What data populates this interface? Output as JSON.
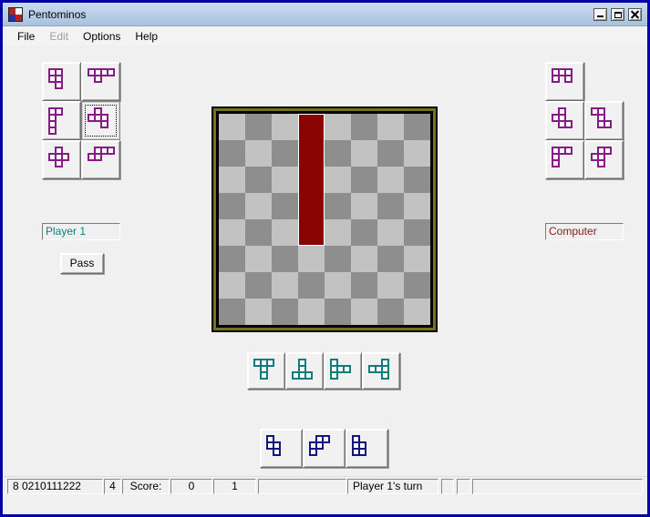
{
  "window": {
    "title": "Pentominos"
  },
  "menu": {
    "items": [
      {
        "label": "File",
        "enabled": true
      },
      {
        "label": "Edit",
        "enabled": false
      },
      {
        "label": "Options",
        "enabled": true
      },
      {
        "label": "Help",
        "enabled": true
      }
    ]
  },
  "players": {
    "left": {
      "name": "Player 1",
      "name_color": "#0e8080"
    },
    "right": {
      "name": "Computer",
      "name_color": "#8b1a1a"
    }
  },
  "pass_button": {
    "label": "Pass"
  },
  "board": {
    "rows": 8,
    "cols": 8,
    "cell_size": 29,
    "light_color": "#c2c2c2",
    "dark_color": "#8e8e8e",
    "placed_piece": {
      "name": "I-pentomino",
      "color": "#8b0404",
      "col": 3,
      "row": 0,
      "width_cells": 1,
      "height_cells": 5
    }
  },
  "pieces": {
    "player_left": {
      "color": "#871a87",
      "items": [
        {
          "name": "P-pentomino",
          "cells": [
            [
              0,
              0
            ],
            [
              1,
              0
            ],
            [
              0,
              1
            ],
            [
              1,
              1
            ],
            [
              1,
              2
            ]
          ],
          "selected": false
        },
        {
          "name": "Y-pentomino",
          "cells": [
            [
              0,
              0
            ],
            [
              1,
              0
            ],
            [
              2,
              0
            ],
            [
              3,
              0
            ],
            [
              1,
              1
            ]
          ],
          "selected": false
        },
        {
          "name": "L-pentomino",
          "cells": [
            [
              0,
              0
            ],
            [
              1,
              0
            ],
            [
              0,
              1
            ],
            [
              0,
              2
            ],
            [
              0,
              3
            ]
          ],
          "selected": false
        },
        {
          "name": "F-pentomino",
          "cells": [
            [
              1,
              0
            ],
            [
              0,
              1
            ],
            [
              1,
              1
            ],
            [
              2,
              1
            ],
            [
              2,
              2
            ]
          ],
          "selected": true
        },
        {
          "name": "X-pentomino",
          "cells": [
            [
              1,
              0
            ],
            [
              0,
              1
            ],
            [
              1,
              1
            ],
            [
              2,
              1
            ],
            [
              1,
              2
            ]
          ],
          "selected": false
        },
        {
          "name": "N-pentomino",
          "cells": [
            [
              1,
              0
            ],
            [
              2,
              0
            ],
            [
              3,
              0
            ],
            [
              0,
              1
            ],
            [
              1,
              1
            ]
          ],
          "selected": false
        }
      ]
    },
    "computer_right": {
      "color": "#871a87",
      "items": [
        {
          "name": "U-pentomino",
          "cells": [
            [
              0,
              0
            ],
            [
              1,
              0
            ],
            [
              2,
              0
            ],
            [
              0,
              1
            ],
            [
              2,
              1
            ]
          ],
          "selected": false
        },
        {
          "name": "W-pentomino",
          "cells": [
            [
              1,
              0
            ],
            [
              0,
              1
            ],
            [
              1,
              1
            ],
            [
              1,
              2
            ],
            [
              2,
              2
            ]
          ],
          "selected": false
        },
        {
          "name": "Z-pentomino",
          "cells": [
            [
              0,
              0
            ],
            [
              1,
              0
            ],
            [
              1,
              1
            ],
            [
              1,
              2
            ],
            [
              2,
              2
            ]
          ],
          "selected": false
        },
        {
          "name": "V-pentomino",
          "cells": [
            [
              0,
              0
            ],
            [
              1,
              0
            ],
            [
              2,
              0
            ],
            [
              0,
              1
            ],
            [
              0,
              2
            ]
          ],
          "selected": false
        },
        {
          "name": "F-pentomino",
          "cells": [
            [
              1,
              0
            ],
            [
              2,
              0
            ],
            [
              0,
              1
            ],
            [
              1,
              1
            ],
            [
              1,
              2
            ]
          ],
          "selected": false
        }
      ]
    },
    "rotation_row": {
      "color": "#0e7c7c",
      "items": [
        {
          "name": "T-rotation-up",
          "cells": [
            [
              0,
              0
            ],
            [
              1,
              0
            ],
            [
              2,
              0
            ],
            [
              1,
              1
            ],
            [
              1,
              2
            ]
          ],
          "selected": false
        },
        {
          "name": "T-rotation-down",
          "cells": [
            [
              1,
              0
            ],
            [
              1,
              1
            ],
            [
              0,
              2
            ],
            [
              1,
              2
            ],
            [
              2,
              2
            ]
          ],
          "selected": false
        },
        {
          "name": "T-rotation-right",
          "cells": [
            [
              0,
              0
            ],
            [
              0,
              1
            ],
            [
              1,
              1
            ],
            [
              2,
              1
            ],
            [
              0,
              2
            ]
          ],
          "selected": false
        },
        {
          "name": "T-rotation-left",
          "cells": [
            [
              2,
              0
            ],
            [
              0,
              1
            ],
            [
              1,
              1
            ],
            [
              2,
              1
            ],
            [
              2,
              2
            ]
          ],
          "selected": false
        }
      ]
    },
    "transform_row": {
      "color": "#14147e",
      "items": [
        {
          "name": "S-transform",
          "cells": [
            [
              0,
              0
            ],
            [
              0,
              1
            ],
            [
              1,
              1
            ],
            [
              1,
              2
            ]
          ],
          "selected": false
        },
        {
          "name": "W-transform",
          "cells": [
            [
              1,
              0
            ],
            [
              2,
              0
            ],
            [
              0,
              1
            ],
            [
              1,
              1
            ],
            [
              0,
              2
            ]
          ],
          "selected": false
        },
        {
          "name": "P-transform",
          "cells": [
            [
              0,
              0
            ],
            [
              0,
              1
            ],
            [
              1,
              1
            ],
            [
              0,
              2
            ],
            [
              1,
              2
            ]
          ],
          "selected": false
        }
      ]
    }
  },
  "status_bar": {
    "panels": [
      "8 0210111222",
      "4",
      "Score:",
      "0",
      "1",
      "",
      "Player 1's turn",
      "",
      "",
      ""
    ]
  }
}
